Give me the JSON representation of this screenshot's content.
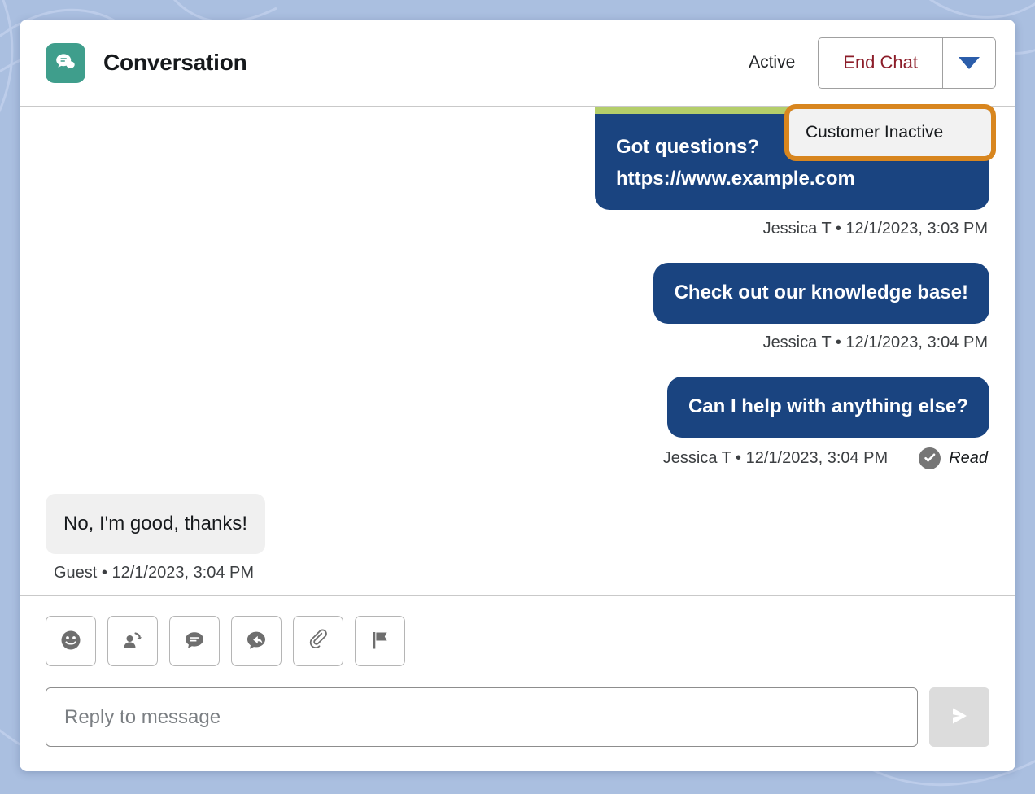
{
  "window": {
    "background_color": "#aabfe0"
  },
  "header": {
    "logo_icon": "chat-bubbles-icon",
    "title": "Conversation",
    "status": "Active",
    "end_chat_label": "End Chat",
    "end_chat_color": "#8c1d29",
    "caret_icon": "chevron-down-icon",
    "caret_color": "#2b5daa"
  },
  "dropdown": {
    "highlight_color": "#d8861f",
    "items": [
      {
        "label": "Customer Inactive",
        "focused": true
      }
    ]
  },
  "messages": [
    {
      "direction": "out",
      "clipped": true,
      "line1": "Got questions?",
      "line2": "https://www.example.com",
      "author": "Jessica T",
      "timestamp": "12/1/2023, 3:03 PM",
      "meta": "Jessica T • 12/1/2023, 3:03 PM",
      "receipt": null
    },
    {
      "direction": "out",
      "clipped": false,
      "text": "Check out our knowledge base!",
      "author": "Jessica T",
      "timestamp": "12/1/2023, 3:04 PM",
      "meta": "Jessica T • 12/1/2023, 3:04 PM",
      "receipt": null
    },
    {
      "direction": "out",
      "clipped": false,
      "text": "Can I help with anything else?",
      "author": "Jessica T",
      "timestamp": "12/1/2023, 3:04 PM",
      "meta": "Jessica T • 12/1/2023, 3:04 PM",
      "receipt": "Read"
    },
    {
      "direction": "in",
      "clipped": false,
      "text": "No, I'm good, thanks!",
      "author": "Guest",
      "timestamp": "12/1/2023, 3:04 PM",
      "meta": "Guest • 12/1/2023, 3:04 PM",
      "receipt": null
    }
  ],
  "composer": {
    "tools": [
      {
        "icon": "emoji-smiley-icon"
      },
      {
        "icon": "transfer-user-icon"
      },
      {
        "icon": "quick-text-icon"
      },
      {
        "icon": "end-conversation-icon"
      },
      {
        "icon": "attachment-paperclip-icon"
      },
      {
        "icon": "flag-icon"
      }
    ],
    "input_placeholder": "Reply to message",
    "input_value": "",
    "send_icon": "send-paper-plane-icon",
    "send_enabled": false
  },
  "colors": {
    "agent_bubble": "#1a4480",
    "guest_bubble": "#f0f0f0",
    "green_strip": "#b4ce6a",
    "logo_teal": "#3f9e8c"
  }
}
